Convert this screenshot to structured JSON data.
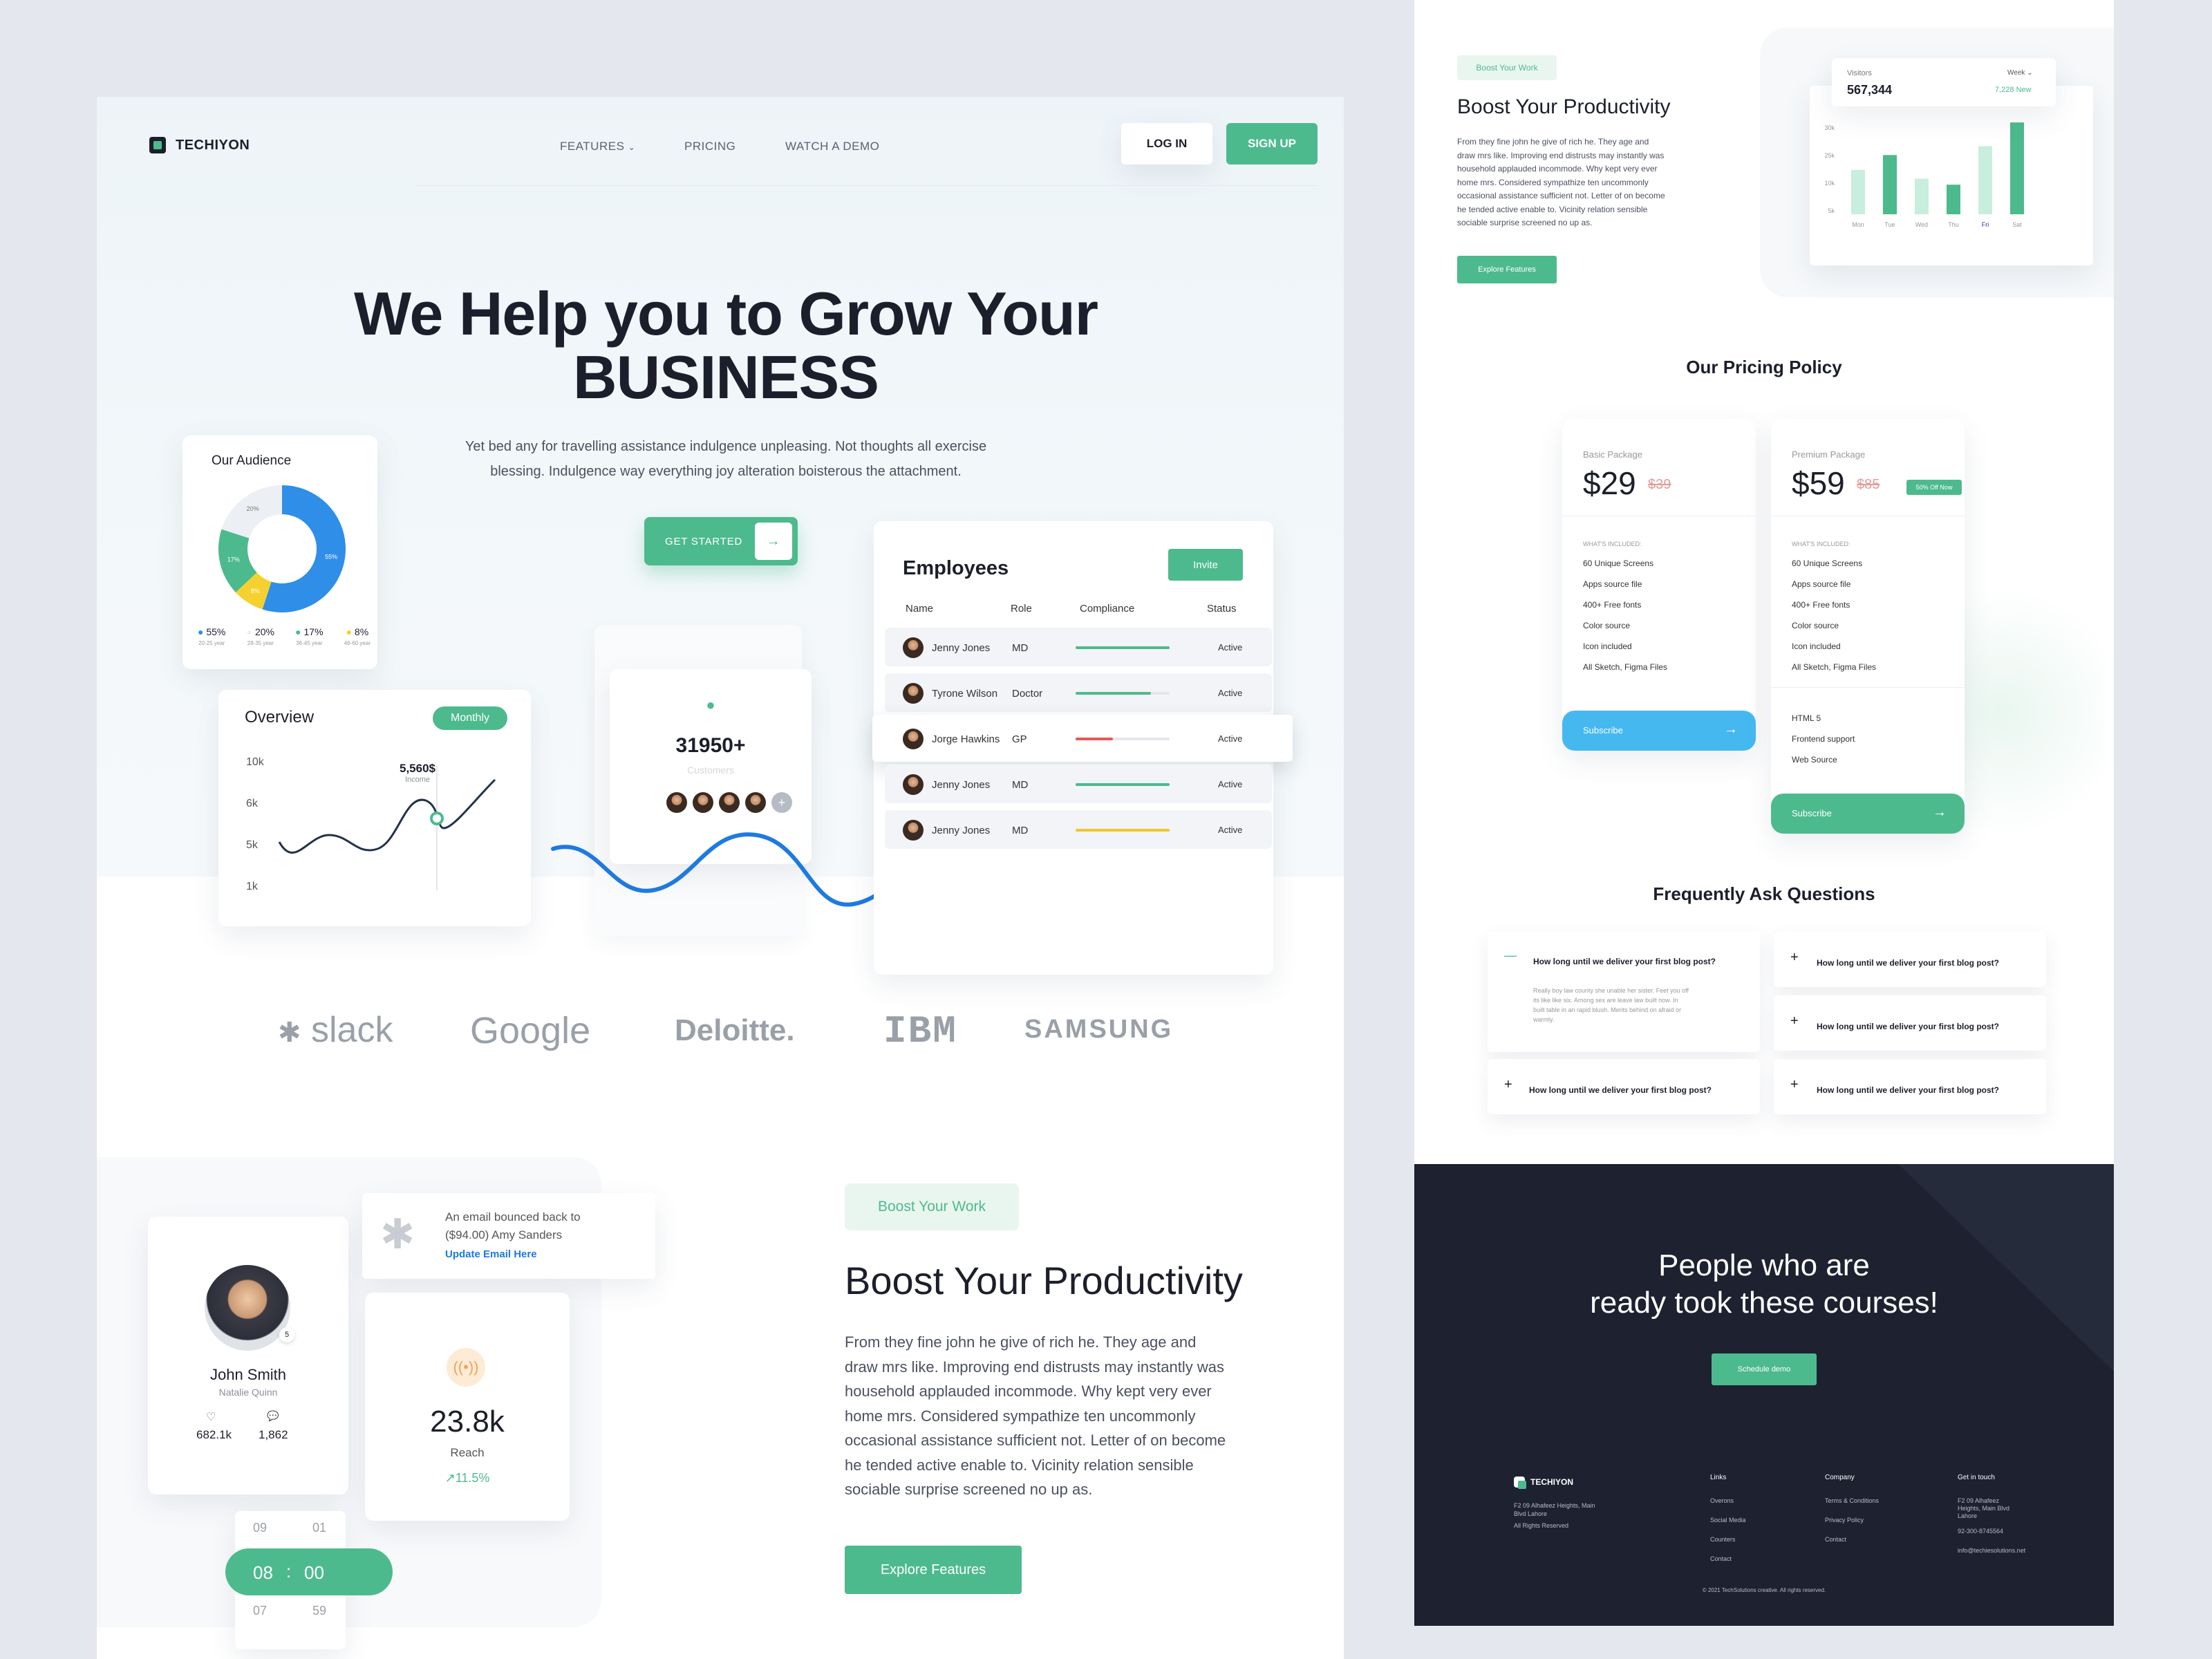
{
  "brand": {
    "name": "TECHIYON"
  },
  "nav": {
    "features": "FEATURES",
    "pricing": "PRICING",
    "watch_demo": "WATCH A DEMO",
    "login": "LOG IN",
    "signup": "SIGN UP"
  },
  "hero": {
    "title_line1": "We Help you to Grow Your",
    "title_line2": "BUSINESS",
    "subtitle_line1": "Yet bed any for travelling assistance indulgence unpleasing. Not thoughts all exercise",
    "subtitle_line2": "blessing. Indulgence way everything joy alteration boisterous the attachment.",
    "cta": "GET STARTED"
  },
  "audience": {
    "title": "Our Audience",
    "slices": [
      {
        "label": "55%",
        "value": 55,
        "color": "#2f8ee8",
        "range": "20-25 year"
      },
      {
        "label": "20%",
        "value": 20,
        "color": "#eceff3",
        "range": "28-35 year"
      },
      {
        "label": "17%",
        "value": 17,
        "color": "#4dba8e",
        "range": "36-45 year"
      },
      {
        "label": "8%",
        "value": 8,
        "color": "#f4d12f",
        "range": "46-60 year"
      }
    ]
  },
  "overview": {
    "title": "Overview",
    "period": "Monthly",
    "y_ticks": [
      "10k",
      "6k",
      "5k",
      "1k"
    ],
    "tooltip_value": "5,560$",
    "tooltip_label": "Income"
  },
  "customers": {
    "count": "31950+",
    "label": "Customers"
  },
  "employees": {
    "title": "Employees",
    "invite": "Invite",
    "headers": [
      "Name",
      "Role",
      "Compliance",
      "Status"
    ],
    "rows": [
      {
        "name": "Jenny Jones",
        "role": "MD",
        "compliance": 1.0,
        "color": "#4dba8e",
        "status": "Active"
      },
      {
        "name": "Tyrone Wilson",
        "role": "Doctor",
        "compliance": 0.8,
        "color": "#4dba8e",
        "status": "Active"
      },
      {
        "name": "Jorge Hawkins",
        "role": "GP",
        "compliance": 0.4,
        "color": "#e85656",
        "status": "Active"
      },
      {
        "name": "Jenny Jones",
        "role": "MD",
        "compliance": 1.0,
        "color": "#4dba8e",
        "status": "Active"
      },
      {
        "name": "Jenny Jones",
        "role": "MD",
        "compliance": 1.0,
        "color": "#f4c430",
        "status": "Active"
      }
    ]
  },
  "logos": [
    "slack",
    "Google",
    "Deloitte.",
    "IBM",
    "SAMSUNG"
  ],
  "profile": {
    "name": "John Smith",
    "subtitle": "Natalie Quinn",
    "badge": "5",
    "likes": "682.1k",
    "comments": "1,862"
  },
  "notification": {
    "text_line1": "An email bounced back to",
    "text_line2": "($94.00) Amy Sanders",
    "link": "Update Email Here"
  },
  "reach": {
    "value": "23.8k",
    "label": "Reach",
    "change": "11.5%"
  },
  "time_picker": {
    "above": [
      "09",
      "01"
    ],
    "hours": "08",
    "minutes": "00",
    "below": [
      "07",
      "59"
    ]
  },
  "boost": {
    "tag": "Boost Your Work",
    "title": "Boost Your Productivity",
    "body_lines": [
      "From they fine john he give of rich he. They age and",
      "draw mrs like. Improving end distrusts may instantly was",
      "household applauded incommode. Why kept very ever",
      "home mrs. Considered sympathize ten uncommonly",
      "occasional assistance sufficient not. Letter of on become",
      "he tended active enable to. Vicinity relation sensible",
      "sociable surprise screened no up as."
    ],
    "cta": "Explore Features"
  },
  "right_boost": {
    "tag": "Boost Your Work",
    "title": "Boost Your Productivity",
    "body_lines": [
      "From they fine john he give of rich he. They age and",
      "draw mrs like. Improving end distrusts may instantly was",
      "household applauded incommode. Why kept very ever",
      "home mrs. Considered sympathize ten uncommonly",
      "occasional assistance sufficient not. Letter of on become",
      "he tended active enable to. Vicinity relation sensible",
      "sociable surprise screened no up as."
    ],
    "cta": "Explore Features"
  },
  "visitors": {
    "label": "Visitors",
    "value": "567,344",
    "period": "Week",
    "new": "7,228 New"
  },
  "chart_data": {
    "type": "bar",
    "categories": [
      "Mon",
      "Tue",
      "Wed",
      "Thu",
      "Fri",
      "Sat"
    ],
    "values": [
      15,
      20,
      12,
      10,
      23,
      31
    ],
    "highlight": [
      false,
      true,
      false,
      true,
      false,
      true
    ],
    "ylim": [
      0,
      35
    ],
    "y_ticks": [
      "30k",
      "25k",
      "10k",
      "5k"
    ],
    "xlabel": "",
    "ylabel": ""
  },
  "pricing": {
    "title": "Our Pricing Policy",
    "plans": [
      {
        "name": "Basic Package",
        "price": "$29",
        "old_price": "$39",
        "included_label": "WHAT'S INCLUDED:",
        "features": [
          "60 Unique Screens",
          "Apps source file",
          "400+ Free fonts",
          "Color source",
          "Icon included",
          "All Sketch, Figma Files"
        ],
        "button": "Subscribe"
      },
      {
        "name": "Premium Package",
        "price": "$59",
        "old_price": "$85",
        "badge": "50% Off Now",
        "included_label": "WHAT'S INCLUDED:",
        "features": [
          "60 Unique Screens",
          "Apps source file",
          "400+ Free fonts",
          "Color source",
          "Icon included",
          "All Sketch, Figma Files"
        ],
        "extras": [
          "HTML 5",
          "Frontend support",
          "Web Source"
        ],
        "button": "Subscribe"
      }
    ]
  },
  "faq": {
    "title": "Frequently Ask Questions",
    "question": "How long until we deliver your first blog post?",
    "answer_lines": [
      "Really boy law county she unable her sister. Feet you off",
      "its like like six. Among sex are leave law built now. In",
      "built table in an rapid blush. Merits behind on afraid or",
      "warmly."
    ]
  },
  "courses": {
    "title_line1": "People who are",
    "title_line2": "ready took these courses!",
    "cta": "Schedule demo"
  },
  "footer": {
    "brand": "TECHIYON",
    "address_lines": [
      "F2 09 Alhafeez Heights, Main",
      "Blvd Lahore"
    ],
    "rights": "All Rights Reserved",
    "links_title": "Links",
    "links": [
      "Overons",
      "Social Media",
      "Counters",
      "Contact"
    ],
    "company_title": "Company",
    "company": [
      "Terms & Conditions",
      "Privacy Policy",
      "Contact"
    ],
    "contact_title": "Get in touch",
    "contact_lines": [
      "F2 09 Alhafeez",
      "Heights, Main Blvd",
      "Lahore"
    ],
    "phone": "92-300-8745564",
    "email": "info@techiesolutions.net",
    "copyright": "© 2021 TechSolutions creative. All rights reserved."
  }
}
